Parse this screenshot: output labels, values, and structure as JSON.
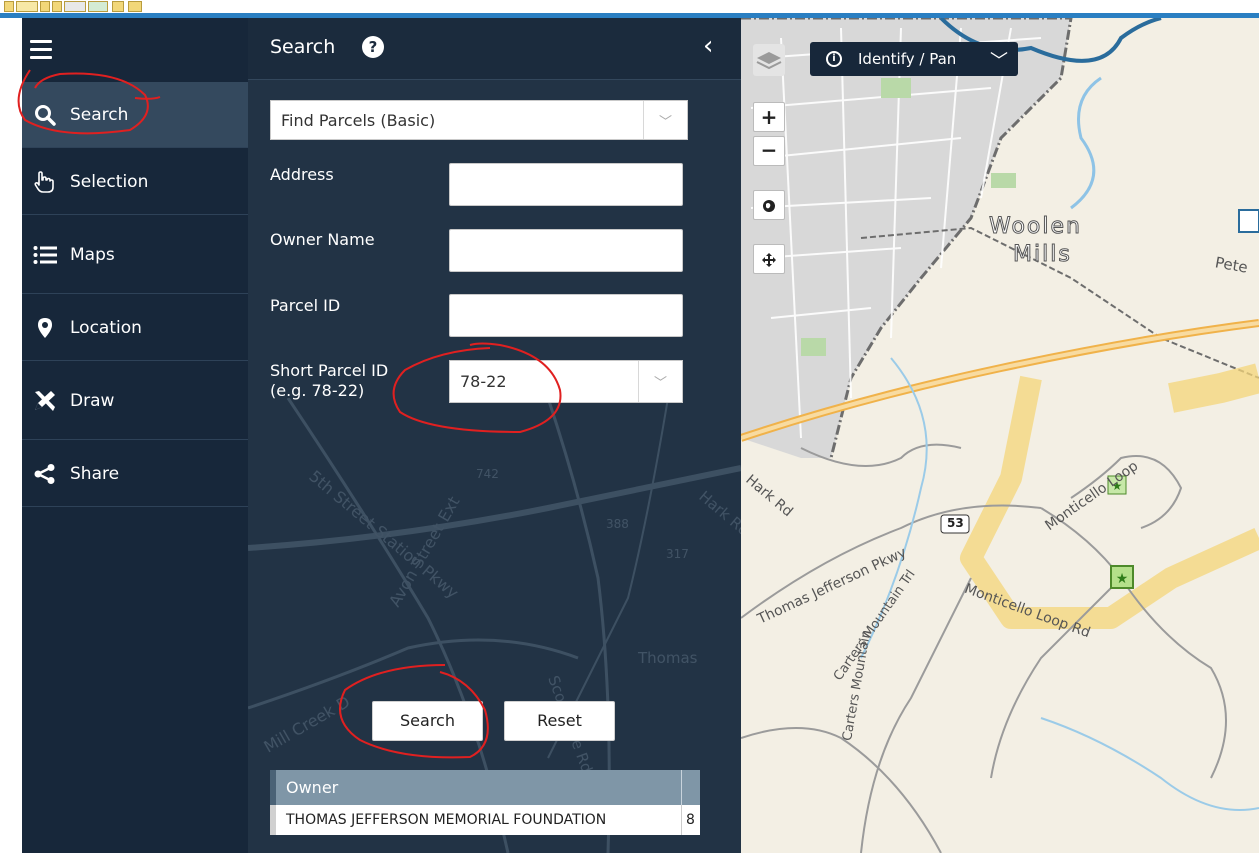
{
  "nav": {
    "items": [
      {
        "label": "Search",
        "icon": "search-icon",
        "active": true
      },
      {
        "label": "Selection",
        "icon": "hand-pointer-icon",
        "active": false
      },
      {
        "label": "Maps",
        "icon": "list-icon",
        "active": false
      },
      {
        "label": "Location",
        "icon": "map-pin-icon",
        "active": false
      },
      {
        "label": "Draw",
        "icon": "draw-tools-icon",
        "active": false
      },
      {
        "label": "Share",
        "icon": "share-icon",
        "active": false
      }
    ]
  },
  "panel": {
    "title": "Search",
    "search_type": "Find Parcels (Basic)",
    "fields": {
      "address_label": "Address",
      "address_value": "",
      "owner_label": "Owner Name",
      "owner_value": "",
      "parcel_label": "Parcel ID",
      "parcel_value": "",
      "short_parcel_label": "Short Parcel ID",
      "short_parcel_hint": "(e.g. 78-22)",
      "short_parcel_value": "78-22"
    },
    "buttons": {
      "search": "Search",
      "reset": "Reset"
    },
    "results": {
      "columns": [
        "Owner",
        ""
      ],
      "rows": [
        [
          "THOMAS JEFFERSON MEMORIAL FOUNDATION",
          "8"
        ]
      ]
    },
    "background_map_labels": [
      "5th Street Station Pkwy",
      "Avon Street Ext",
      "Mill Creek D",
      "Scottsville Rd",
      "Thomas",
      "Hark Rd",
      "742",
      "388",
      "317"
    ]
  },
  "map": {
    "tool_mode": "Identify / Pan",
    "zoom_in": "+",
    "zoom_out": "−",
    "labels": [
      "Woolen",
      "Mills",
      "Pete",
      "53",
      "Monticello Loop",
      "Monticello Loop Rd",
      "Thomas Jefferson Pkwy",
      "Carters Mountain Trl",
      "Carters Mountain",
      "Hark Rd"
    ]
  },
  "colors": {
    "nav_bg": "#17273a",
    "panel_bg": "#223345",
    "active_nav": "#34495e",
    "accent_blue": "#2a7fc2",
    "annotation_red": "#e02020",
    "map_bg": "#f3efe4",
    "highlight_road": "#f4d679"
  }
}
